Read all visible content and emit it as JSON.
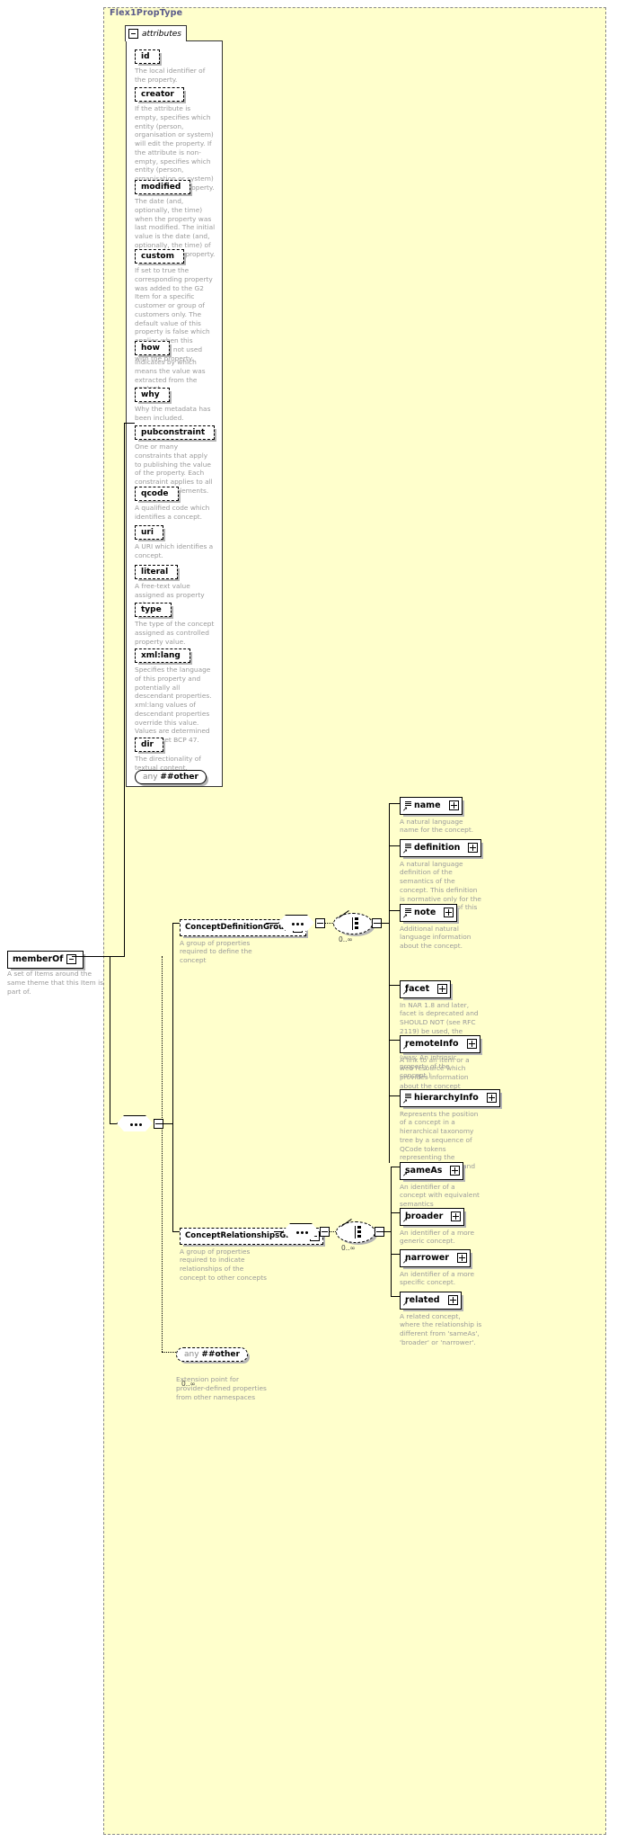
{
  "diagram": {
    "type_name": "Flex1PropType",
    "attributes_label": "attributes",
    "root_element": {
      "name": "memberOf",
      "description": "A set of Items around the same theme that this Item is part of."
    },
    "attributes": [
      {
        "name": "id",
        "description": "The local identifier of the property."
      },
      {
        "name": "creator",
        "description": "If the attribute is empty, specifies which entity (person, organisation or system) will edit the property. If the attribute is non-empty, specifies which entity (person, organisation or system) has edited the property."
      },
      {
        "name": "modified",
        "description": "The date (and, optionally, the time) when the property was last modified. The initial value is the date (and, optionally, the time) of creation of the property."
      },
      {
        "name": "custom",
        "description": "If set to true the corresponding property was added to the G2 Item for a specific customer or group of customers only. The default value of this property is false which applies when this attribute is not used with the property."
      },
      {
        "name": "how",
        "description": "Indicates by which means the value was extracted from the content."
      },
      {
        "name": "why",
        "description": "Why the metadata has been included."
      },
      {
        "name": "pubconstraint",
        "description": "One or many constraints that apply to publishing the value of the property. Each constraint applies to all descendant elements."
      },
      {
        "name": "qcode",
        "description": "A qualified code which identifies a concept."
      },
      {
        "name": "uri",
        "description": "A URI which identifies a concept."
      },
      {
        "name": "literal",
        "description": "A free-text value assigned as property value."
      },
      {
        "name": "type",
        "description": "The type of the concept assigned as controlled property value."
      },
      {
        "name": "xml:lang",
        "description": "Specifies the language of this property and potentially all descendant properties. xml:lang values of descendant properties override this value. Values are determined by Internet BCP 47."
      },
      {
        "name": "dir",
        "description": "The directionality of textual content."
      }
    ],
    "attributes_any": {
      "prefix": "any",
      "namespace": "##other"
    },
    "groups": [
      {
        "name": "ConceptDefinitionGroup",
        "description": "A group of properties required to define the concept",
        "occurrence": "0..∞",
        "children": [
          {
            "name": "name",
            "description": "A natural language name for the concept."
          },
          {
            "name": "definition",
            "description": "A natural language definition of the semantics of the concept. This definition is normative only for the scope of the use of this concept."
          },
          {
            "name": "note",
            "description": "Additional natural language information about the concept."
          },
          {
            "name": "facet",
            "description": "In NAR 1.8 and later, facet is deprecated and SHOULD NOT (see RFC 2119) be used, the \"related\" property should be used instead (was: An intrinsic property of the concept.)"
          },
          {
            "name": "remoteInfo",
            "description": "A link to an item or a web resource which provides information about the concept"
          },
          {
            "name": "hierarchyInfo",
            "description": "Represents the position of a concept in a hierarchical taxonomy tree by a sequence of QCode tokens representing the ancestor concepts and this concept"
          }
        ]
      },
      {
        "name": "ConceptRelationshipsGroup",
        "description": "A group of properties required to indicate relationships of the concept to other concepts",
        "occurrence": "0..∞",
        "children": [
          {
            "name": "sameAs",
            "description": "An identifier of a concept with equivalent semantics"
          },
          {
            "name": "broader",
            "description": "An identifier of a more generic concept."
          },
          {
            "name": "narrower",
            "description": "An identifier of a more specific concept."
          },
          {
            "name": "related",
            "description": "A related concept, where the relationship is different from 'sameAs', 'broader' or 'narrower'."
          }
        ]
      }
    ],
    "bottom_any": {
      "prefix": "any",
      "namespace": "##other",
      "occurrence": "0..∞",
      "description": "Extension point for provider-defined properties from other namespaces"
    },
    "colors": {
      "panel_background": "#ffffcc",
      "box_background": "#ffffff",
      "description_text": "#9a9a9a",
      "title_text": "#5a5a8a",
      "line": "#000000",
      "shadow": "#b5b5b5"
    }
  }
}
